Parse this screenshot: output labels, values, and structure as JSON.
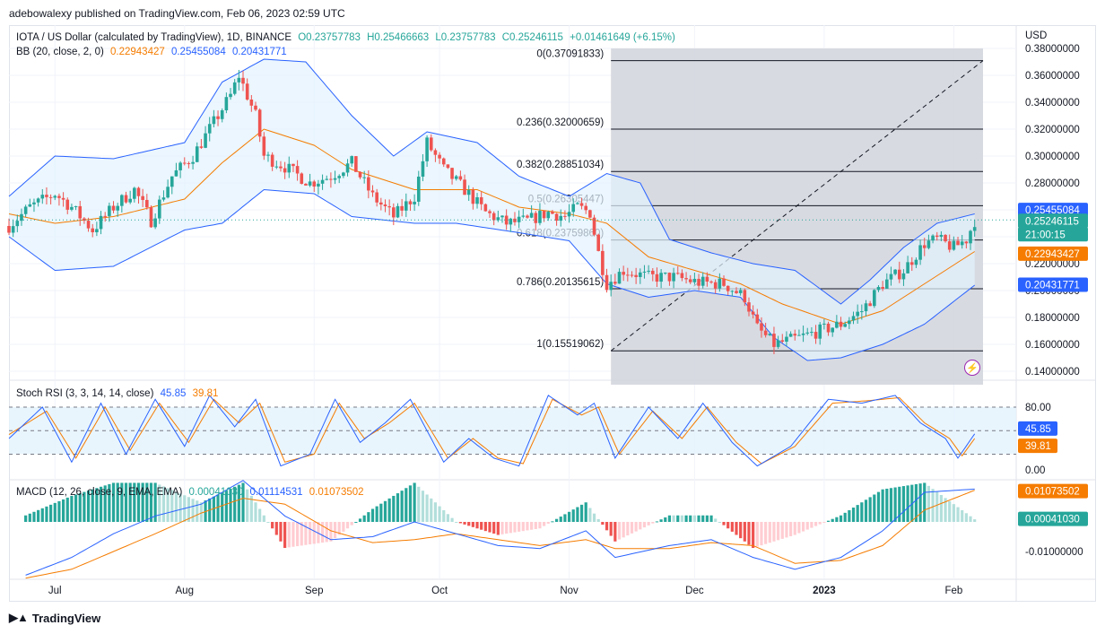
{
  "publisher": "adebowalexy published on TradingView.com, Feb 06, 2023 02:59 UTC",
  "brand": "TradingView",
  "currency": "USD",
  "colors": {
    "up": "#26a69a",
    "down": "#ef5350",
    "bb_upper": "#2962ff",
    "bb_lower": "#2962ff",
    "bb_basis": "#f57c00",
    "bb_fill": "#e3f2fd",
    "fib_zone": "#d1d4dc",
    "stoch_k": "#2962ff",
    "stoch_d": "#f57c00",
    "macd": "#2962ff",
    "signal": "#f57c00",
    "hist_up_strong": "#26a69a",
    "hist_up_weak": "#b2dfdb",
    "hist_down_strong": "#ef5350",
    "hist_down_weak": "#ffcdd2",
    "alert_icon": "#9c27b0"
  },
  "legend_main": {
    "symbol": "IOTA / US Dollar (calculated by TradingView), 1D, BINANCE",
    "o": "O0.23757783",
    "h": "H0.25466663",
    "l": "L0.23757783",
    "c": "C0.25246115",
    "chg": "+0.01461649 (+6.15%)"
  },
  "legend_bb": {
    "name": "BB (20, close, 2, 0)",
    "basis": "0.22943427",
    "upper": "0.25455084",
    "lower": "0.20431771"
  },
  "legend_stoch": {
    "name": "Stoch RSI (3, 3, 14, 14, close)",
    "k": "45.85",
    "d": "39.81"
  },
  "legend_macd": {
    "name": "MACD (12, 26, close, 9, EMA, EMA)",
    "hist": "0.00041030",
    "macd": "0.01114531",
    "signal": "0.01073502"
  },
  "price_axis": {
    "ticks": [
      "0.38000000",
      "0.36000000",
      "0.34000000",
      "0.32000000",
      "0.30000000",
      "0.28000000",
      "0.26000000",
      "0.24000000",
      "0.22000000",
      "0.20000000",
      "0.18000000",
      "0.16000000",
      "0.14000000"
    ]
  },
  "price_badges": [
    {
      "name": "bb-upper-badge",
      "text": "0.25455084",
      "color": "#2962ff"
    },
    {
      "name": "last-price-badge",
      "text": "0.25246115",
      "color": "#26a69a"
    },
    {
      "name": "countdown-badge",
      "text": "21:00:15",
      "color": "#26a69a"
    },
    {
      "name": "bb-basis-badge",
      "text": "0.22943427",
      "color": "#f57c00"
    },
    {
      "name": "bb-lower-badge",
      "text": "0.20431771",
      "color": "#2962ff"
    }
  ],
  "stoch_axis": {
    "ticks": [
      "80.00",
      "0.00"
    ],
    "badges": [
      {
        "text": "45.85",
        "color": "#2962ff"
      },
      {
        "text": "39.81",
        "color": "#f57c00"
      }
    ]
  },
  "macd_axis": {
    "ticks": [
      "-0.01000000"
    ],
    "badges": [
      {
        "text": "0.01073502",
        "color": "#f57c00"
      },
      {
        "text": "0.00041030",
        "color": "#26a69a"
      }
    ]
  },
  "time_axis": [
    "Jul",
    "Aug",
    "Sep",
    "Oct",
    "Nov",
    "Dec",
    "2023",
    "Feb"
  ],
  "fib_levels": [
    {
      "label": "0(0.37091833)",
      "price": 0.37091833
    },
    {
      "label": "0.236(0.32000659)",
      "price": 0.32000659
    },
    {
      "label": "0.382(0.28851034)",
      "price": 0.28851034
    },
    {
      "label": "0.5(0.26305447)",
      "price": 0.26305447
    },
    {
      "label": "0.618(0.23759860)",
      "price": 0.2375986
    },
    {
      "label": "0.786(0.20135615)",
      "price": 0.20135615
    },
    {
      "label": "1(0.15519062)",
      "price": 0.15519062
    }
  ],
  "chart_data": {
    "type": "candlestick",
    "title": "IOTA / US Dollar (calculated by TradingView), 1D, BINANCE",
    "ylim": [
      0.13,
      0.38
    ],
    "x_range": [
      "2022-06-20",
      "2023-02-08"
    ],
    "close_path": [
      [
        "2022-06-20",
        0.248
      ],
      [
        "2022-06-25",
        0.262
      ],
      [
        "2022-07-01",
        0.272
      ],
      [
        "2022-07-05",
        0.262
      ],
      [
        "2022-07-10",
        0.245
      ],
      [
        "2022-07-15",
        0.262
      ],
      [
        "2022-07-20",
        0.275
      ],
      [
        "2022-07-24",
        0.252
      ],
      [
        "2022-07-29",
        0.285
      ],
      [
        "2022-08-03",
        0.3
      ],
      [
        "2022-08-08",
        0.325
      ],
      [
        "2022-08-12",
        0.345
      ],
      [
        "2022-08-14",
        0.36
      ],
      [
        "2022-08-18",
        0.33
      ],
      [
        "2022-08-20",
        0.3
      ],
      [
        "2022-08-25",
        0.292
      ],
      [
        "2022-08-31",
        0.28
      ],
      [
        "2022-09-05",
        0.285
      ],
      [
        "2022-09-10",
        0.295
      ],
      [
        "2022-09-15",
        0.27
      ],
      [
        "2022-09-20",
        0.255
      ],
      [
        "2022-09-25",
        0.27
      ],
      [
        "2022-09-28",
        0.31
      ],
      [
        "2022-10-02",
        0.29
      ],
      [
        "2022-10-07",
        0.275
      ],
      [
        "2022-10-12",
        0.258
      ],
      [
        "2022-10-17",
        0.25
      ],
      [
        "2022-10-22",
        0.252
      ],
      [
        "2022-10-27",
        0.258
      ],
      [
        "2022-10-31",
        0.255
      ],
      [
        "2022-11-03",
        0.262
      ],
      [
        "2022-11-06",
        0.258
      ],
      [
        "2022-11-08",
        0.228
      ],
      [
        "2022-11-10",
        0.205
      ],
      [
        "2022-11-14",
        0.215
      ],
      [
        "2022-11-20",
        0.21
      ],
      [
        "2022-11-26",
        0.21
      ],
      [
        "2022-12-02",
        0.206
      ],
      [
        "2022-12-08",
        0.205
      ],
      [
        "2022-12-13",
        0.195
      ],
      [
        "2022-12-16",
        0.172
      ],
      [
        "2022-12-20",
        0.16
      ],
      [
        "2022-12-26",
        0.165
      ],
      [
        "2022-12-31",
        0.17
      ],
      [
        "2023-01-05",
        0.175
      ],
      [
        "2023-01-10",
        0.185
      ],
      [
        "2023-01-15",
        0.205
      ],
      [
        "2023-01-20",
        0.215
      ],
      [
        "2023-01-25",
        0.235
      ],
      [
        "2023-01-28",
        0.238
      ],
      [
        "2023-02-01",
        0.232
      ],
      [
        "2023-02-04",
        0.238
      ],
      [
        "2023-02-06",
        0.252
      ]
    ],
    "bb_upper": [
      [
        "2022-06-20",
        0.27
      ],
      [
        "2022-07-01",
        0.3
      ],
      [
        "2022-07-15",
        0.298
      ],
      [
        "2022-08-01",
        0.31
      ],
      [
        "2022-08-10",
        0.355
      ],
      [
        "2022-08-20",
        0.372
      ],
      [
        "2022-08-30",
        0.37
      ],
      [
        "2022-09-10",
        0.33
      ],
      [
        "2022-09-20",
        0.3
      ],
      [
        "2022-09-28",
        0.318
      ],
      [
        "2022-10-10",
        0.31
      ],
      [
        "2022-10-20",
        0.285
      ],
      [
        "2022-11-01",
        0.27
      ],
      [
        "2022-11-10",
        0.287
      ],
      [
        "2022-11-18",
        0.28
      ],
      [
        "2022-11-25",
        0.238
      ],
      [
        "2022-12-05",
        0.228
      ],
      [
        "2022-12-15",
        0.22
      ],
      [
        "2022-12-25",
        0.215
      ],
      [
        "2023-01-05",
        0.19
      ],
      [
        "2023-01-12",
        0.208
      ],
      [
        "2023-01-20",
        0.232
      ],
      [
        "2023-01-28",
        0.25
      ],
      [
        "2023-02-06",
        0.257
      ]
    ],
    "bb_basis": [
      [
        "2022-06-20",
        0.257
      ],
      [
        "2022-07-01",
        0.25
      ],
      [
        "2022-07-15",
        0.255
      ],
      [
        "2022-08-01",
        0.268
      ],
      [
        "2022-08-10",
        0.295
      ],
      [
        "2022-08-20",
        0.32
      ],
      [
        "2022-09-01",
        0.308
      ],
      [
        "2022-09-10",
        0.29
      ],
      [
        "2022-09-25",
        0.275
      ],
      [
        "2022-10-10",
        0.275
      ],
      [
        "2022-10-20",
        0.262
      ],
      [
        "2022-11-01",
        0.257
      ],
      [
        "2022-11-10",
        0.25
      ],
      [
        "2022-11-20",
        0.225
      ],
      [
        "2022-12-01",
        0.215
      ],
      [
        "2022-12-12",
        0.205
      ],
      [
        "2022-12-22",
        0.19
      ],
      [
        "2023-01-05",
        0.175
      ],
      [
        "2023-01-15",
        0.185
      ],
      [
        "2023-01-25",
        0.205
      ],
      [
        "2023-02-06",
        0.229
      ]
    ],
    "bb_lower": [
      [
        "2022-06-20",
        0.24
      ],
      [
        "2022-07-01",
        0.215
      ],
      [
        "2022-07-15",
        0.218
      ],
      [
        "2022-08-01",
        0.245
      ],
      [
        "2022-08-10",
        0.25
      ],
      [
        "2022-08-20",
        0.275
      ],
      [
        "2022-09-01",
        0.272
      ],
      [
        "2022-09-10",
        0.255
      ],
      [
        "2022-09-25",
        0.25
      ],
      [
        "2022-10-05",
        0.25
      ],
      [
        "2022-10-20",
        0.243
      ],
      [
        "2022-11-01",
        0.237
      ],
      [
        "2022-11-10",
        0.205
      ],
      [
        "2022-11-20",
        0.195
      ],
      [
        "2022-12-01",
        0.2
      ],
      [
        "2022-12-12",
        0.195
      ],
      [
        "2022-12-20",
        0.165
      ],
      [
        "2022-12-28",
        0.148
      ],
      [
        "2023-01-05",
        0.15
      ],
      [
        "2023-01-15",
        0.16
      ],
      [
        "2023-01-25",
        0.175
      ],
      [
        "2023-02-06",
        0.204
      ]
    ],
    "stoch_k": [
      [
        "2022-06-20",
        40
      ],
      [
        "2022-06-28",
        80
      ],
      [
        "2022-07-05",
        10
      ],
      [
        "2022-07-12",
        85
      ],
      [
        "2022-07-18",
        20
      ],
      [
        "2022-07-25",
        90
      ],
      [
        "2022-08-01",
        30
      ],
      [
        "2022-08-07",
        95
      ],
      [
        "2022-08-13",
        55
      ],
      [
        "2022-08-18",
        90
      ],
      [
        "2022-08-24",
        5
      ],
      [
        "2022-08-31",
        20
      ],
      [
        "2022-09-06",
        90
      ],
      [
        "2022-09-12",
        35
      ],
      [
        "2022-09-18",
        60
      ],
      [
        "2022-09-24",
        90
      ],
      [
        "2022-10-02",
        10
      ],
      [
        "2022-10-08",
        40
      ],
      [
        "2022-10-14",
        15
      ],
      [
        "2022-10-20",
        5
      ],
      [
        "2022-10-27",
        95
      ],
      [
        "2022-11-03",
        70
      ],
      [
        "2022-11-07",
        85
      ],
      [
        "2022-11-12",
        15
      ],
      [
        "2022-11-20",
        80
      ],
      [
        "2022-11-27",
        40
      ],
      [
        "2022-12-03",
        85
      ],
      [
        "2022-12-10",
        35
      ],
      [
        "2022-12-16",
        5
      ],
      [
        "2022-12-24",
        30
      ],
      [
        "2023-01-02",
        90
      ],
      [
        "2023-01-10",
        85
      ],
      [
        "2023-01-18",
        95
      ],
      [
        "2023-01-24",
        60
      ],
      [
        "2023-01-30",
        40
      ],
      [
        "2023-02-02",
        15
      ],
      [
        "2023-02-06",
        46
      ]
    ],
    "stoch_d": [
      [
        "2022-06-20",
        45
      ],
      [
        "2022-06-29",
        75
      ],
      [
        "2022-07-06",
        15
      ],
      [
        "2022-07-13",
        80
      ],
      [
        "2022-07-19",
        25
      ],
      [
        "2022-07-26",
        85
      ],
      [
        "2022-08-02",
        35
      ],
      [
        "2022-08-08",
        90
      ],
      [
        "2022-08-14",
        60
      ],
      [
        "2022-08-19",
        85
      ],
      [
        "2022-08-25",
        10
      ],
      [
        "2022-09-01",
        20
      ],
      [
        "2022-09-07",
        85
      ],
      [
        "2022-09-13",
        40
      ],
      [
        "2022-09-19",
        60
      ],
      [
        "2022-09-25",
        85
      ],
      [
        "2022-10-03",
        15
      ],
      [
        "2022-10-09",
        40
      ],
      [
        "2022-10-15",
        15
      ],
      [
        "2022-10-21",
        8
      ],
      [
        "2022-10-28",
        90
      ],
      [
        "2022-11-04",
        70
      ],
      [
        "2022-11-08",
        80
      ],
      [
        "2022-11-13",
        20
      ],
      [
        "2022-11-21",
        75
      ],
      [
        "2022-11-28",
        40
      ],
      [
        "2022-12-04",
        80
      ],
      [
        "2022-12-11",
        35
      ],
      [
        "2022-12-17",
        8
      ],
      [
        "2022-12-25",
        30
      ],
      [
        "2023-01-03",
        85
      ],
      [
        "2023-01-11",
        88
      ],
      [
        "2023-01-19",
        92
      ],
      [
        "2023-01-25",
        60
      ],
      [
        "2023-01-31",
        40
      ],
      [
        "2023-02-03",
        18
      ],
      [
        "2023-02-06",
        40
      ]
    ],
    "macd": [
      [
        "2022-06-24",
        -0.018
      ],
      [
        "2022-07-05",
        -0.012
      ],
      [
        "2022-07-15",
        -0.004
      ],
      [
        "2022-07-25",
        0.002
      ],
      [
        "2022-08-05",
        0.006
      ],
      [
        "2022-08-15",
        0.014
      ],
      [
        "2022-08-25",
        0.002
      ],
      [
        "2022-09-05",
        -0.006
      ],
      [
        "2022-09-15",
        -0.005
      ],
      [
        "2022-09-25",
        0.0
      ],
      [
        "2022-10-05",
        -0.004
      ],
      [
        "2022-10-15",
        -0.008
      ],
      [
        "2022-10-25",
        -0.009
      ],
      [
        "2022-11-05",
        -0.003
      ],
      [
        "2022-11-12",
        -0.012
      ],
      [
        "2022-11-25",
        -0.008
      ],
      [
        "2022-12-05",
        -0.006
      ],
      [
        "2022-12-15",
        -0.012
      ],
      [
        "2022-12-25",
        -0.016
      ],
      [
        "2023-01-05",
        -0.012
      ],
      [
        "2023-01-15",
        -0.003
      ],
      [
        "2023-01-25",
        0.01
      ],
      [
        "2023-02-06",
        0.0111
      ]
    ],
    "signal": [
      [
        "2022-06-24",
        -0.019
      ],
      [
        "2022-07-05",
        -0.016
      ],
      [
        "2022-07-15",
        -0.01
      ],
      [
        "2022-07-25",
        -0.004
      ],
      [
        "2022-08-05",
        0.003
      ],
      [
        "2022-08-15",
        0.008
      ],
      [
        "2022-08-25",
        0.006
      ],
      [
        "2022-09-05",
        -0.003
      ],
      [
        "2022-09-15",
        -0.007
      ],
      [
        "2022-09-25",
        -0.006
      ],
      [
        "2022-10-05",
        -0.004
      ],
      [
        "2022-10-15",
        -0.006
      ],
      [
        "2022-10-25",
        -0.008
      ],
      [
        "2022-11-05",
        -0.006
      ],
      [
        "2022-11-12",
        -0.009
      ],
      [
        "2022-11-25",
        -0.009
      ],
      [
        "2022-12-05",
        -0.007
      ],
      [
        "2022-12-15",
        -0.008
      ],
      [
        "2022-12-25",
        -0.014
      ],
      [
        "2023-01-05",
        -0.013
      ],
      [
        "2023-01-15",
        -0.008
      ],
      [
        "2023-01-25",
        0.004
      ],
      [
        "2023-02-06",
        0.0107
      ]
    ]
  }
}
